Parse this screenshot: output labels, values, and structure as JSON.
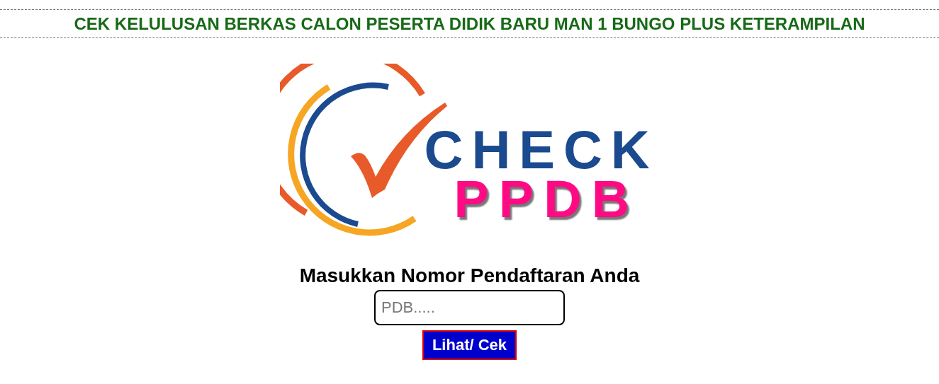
{
  "header": {
    "title": "CEK KELULUSAN BERKAS CALON PESERTA DIDIK BARU MAN 1 BUNGO PLUS KETERAMPILAN"
  },
  "logo": {
    "word_1": "CHECK",
    "word_2": "PPDB"
  },
  "form": {
    "prompt": "Masukkan Nomor Pendaftaran Anda",
    "input": {
      "placeholder": "PDB....."
    },
    "button": "Lihat/ Cek"
  }
}
